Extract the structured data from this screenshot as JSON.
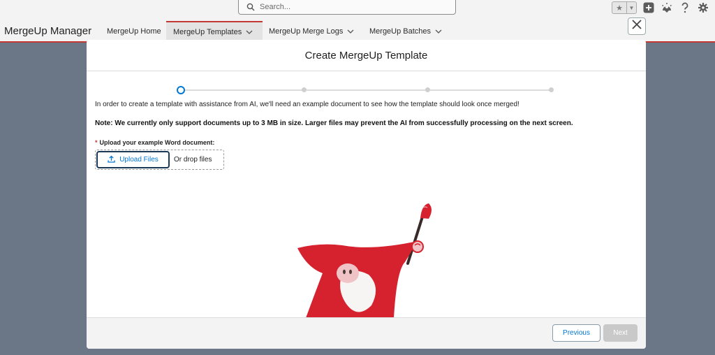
{
  "search": {
    "placeholder": "Search..."
  },
  "app": {
    "name": "MergeUp Manager"
  },
  "nav": {
    "tabs": [
      {
        "label": "MergeUp Home"
      },
      {
        "label": "MergeUp Templates"
      },
      {
        "label": "MergeUp Merge Logs"
      },
      {
        "label": "MergeUp Batches"
      }
    ]
  },
  "modal": {
    "title": "Create MergeUp Template",
    "intro": "In order to create a template with assistance from AI, we'll need an example document to see how the template should look once merged!",
    "note": "Note: We currently only support documents up to 3 MB in size. Larger files may prevent the AI from successfully processing on the next screen.",
    "upload_label": "Upload your example Word document:",
    "required_mark": "*",
    "upload_button": "Upload Files",
    "drop_text": "Or drop files",
    "previous_button": "Previous",
    "next_button": "Next"
  },
  "colors": {
    "brand": "#c23934",
    "accent": "#0176d3",
    "mascot": "#d6222f"
  },
  "icons": [
    "search-icon",
    "star-icon",
    "chevron-down-icon",
    "add-icon",
    "setup-assistant-icon",
    "help-icon",
    "gear-icon",
    "close-icon",
    "upload-icon"
  ]
}
